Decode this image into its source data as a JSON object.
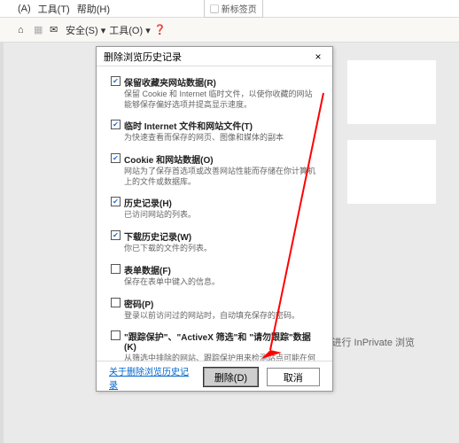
{
  "menu": {
    "i0": "(A)",
    "i1": "工具(T)",
    "i2": "帮助(H)"
  },
  "cmd": {
    "safety": "安全(S) ▾",
    "tools": "工具(O) ▾"
  },
  "newtab": "新标签页",
  "inprivate": "开始进行 InPrivate 浏览",
  "dialog": {
    "title": "删除浏览历史记录",
    "close": "×",
    "opts": [
      {
        "checked": true,
        "label": "保留收藏夹网站数据(R)",
        "desc": "保留 Cookie 和 Internet 临时文件，以使你收藏的网站能够保存偏好选项并提高显示速度。"
      },
      {
        "checked": true,
        "label": "临时 Internet 文件和网站文件(T)",
        "desc": "为快速查看而保存的网页、图像和媒体的副本"
      },
      {
        "checked": true,
        "label": "Cookie 和网站数据(O)",
        "desc": "网站为了保存首选项或改善网站性能而存储在你计算机上的文件或数据库。"
      },
      {
        "checked": true,
        "label": "历史记录(H)",
        "desc": "已访问网站的列表。"
      },
      {
        "checked": true,
        "label": "下载历史记录(W)",
        "desc": "你已下载的文件的列表。"
      },
      {
        "checked": false,
        "label": "表单数据(F)",
        "desc": "保存在表单中键入的信息。"
      },
      {
        "checked": false,
        "label": "密码(P)",
        "desc": "登录以前访问过的网站时，自动填充保存的密码。"
      },
      {
        "checked": false,
        "label": "\"跟踪保护\"、\"ActiveX 筛选\"和 \"请勿跟踪\"数据(K)",
        "desc": "从筛选中排除的网站、跟踪保护用来检测站点可能在何处自动共享你的相关访问详细信息的数据以及\"请勿跟踪\"请求的例外的列表。"
      }
    ],
    "link": "关于删除浏览历史记录",
    "delete_btn": "删除(D)",
    "cancel_btn": "取消"
  }
}
